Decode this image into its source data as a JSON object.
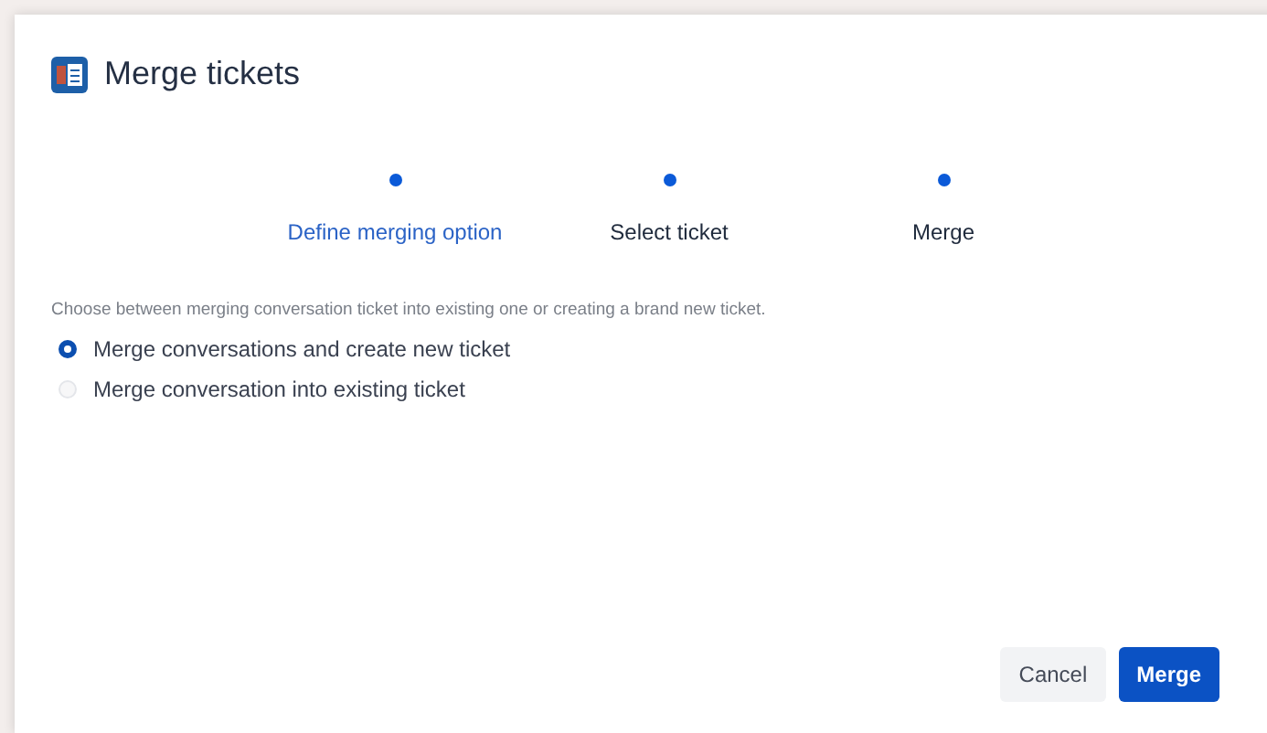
{
  "dialog": {
    "title": "Merge tickets"
  },
  "steps": [
    {
      "label": "Define merging option",
      "selected": true
    },
    {
      "label": "Select ticket",
      "selected": false
    },
    {
      "label": "Merge",
      "selected": false
    }
  ],
  "description": "Choose between merging conversation ticket into existing one or creating a brand new ticket.",
  "options": [
    {
      "label": "Merge conversations and create new ticket",
      "selected": true
    },
    {
      "label": "Merge conversation into existing ticket",
      "selected": false
    }
  ],
  "buttons": [
    {
      "label": "Cancel",
      "kind": "secondary"
    },
    {
      "label": "Merge",
      "kind": "primary"
    }
  ]
}
